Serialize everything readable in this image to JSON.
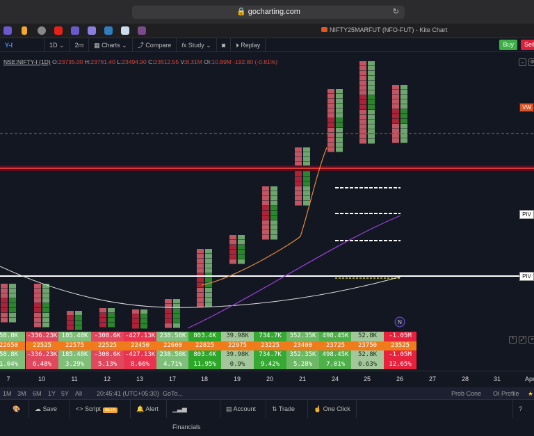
{
  "browser": {
    "url": "gocharting.com",
    "tab_title": "NIFTY25MARFUT (NFO-FUT) - Kite Chart"
  },
  "toolbar": {
    "symbol": "Y-I",
    "interval": "1D",
    "timeframe": "2m",
    "charts": "Charts",
    "compare": "Compare",
    "study": "Study",
    "replay": "Replay",
    "buy": "Buy",
    "sell": "Sell"
  },
  "legend": {
    "symbol": "NSE:NIFTY-I (1D)",
    "o_label": "O:",
    "o": "23735.00",
    "h_label": "H:",
    "h": "23761.40",
    "l_label": "L:",
    "l": "23494.90",
    "c_label": "C:",
    "c": "23512.55",
    "v_label": "V:",
    "v": "8.31M",
    "oi_label": "OI:",
    "oi": "10.89M",
    "change": "-192.80",
    "change_pct": "(-0.81%)"
  },
  "right_labels": {
    "vwap": "VW",
    "pivot1": "PIV",
    "pivot2": "PIV"
  },
  "marker": "N",
  "table": {
    "columns": [
      {
        "day": "7",
        "r1": "58.8K",
        "r2": "22650",
        "r3": "58.8K",
        "r4": "1.04%",
        "color": "#7fbf7a"
      },
      {
        "day": "10",
        "r1": "-336.23K",
        "r2": "22525",
        "r3": "-336.23K",
        "r4": "6.48%",
        "color": "#e0485e"
      },
      {
        "day": "11",
        "r1": "185.48K",
        "r2": "22575",
        "r3": "185.48K",
        "r4": "3.29%",
        "color": "#7fbf7a"
      },
      {
        "day": "12",
        "r1": "-300.6K",
        "r2": "22525",
        "r3": "-300.6K",
        "r4": "5.13%",
        "color": "#e0485e"
      },
      {
        "day": "13",
        "r1": "-427.13K",
        "r2": "22450",
        "r3": "-427.13K",
        "r4": "8.66%",
        "color": "#e8344f"
      },
      {
        "day": "17",
        "r1": "238.58K",
        "r2": "22600",
        "r3": "238.58K",
        "r4": "4.71%",
        "color": "#7fbf7a"
      },
      {
        "day": "18",
        "r1": "803.4K",
        "r2": "22825",
        "r3": "803.4K",
        "r4": "11.95%",
        "color": "#2ea62a"
      },
      {
        "day": "19",
        "r1": "39.98K",
        "r2": "22975",
        "r3": "39.98K",
        "r4": "0.9%",
        "color": "#a3c79a"
      },
      {
        "day": "20",
        "r1": "734.7K",
        "r2": "23225",
        "r3": "734.7K",
        "r4": "9.42%",
        "color": "#36a833"
      },
      {
        "day": "21",
        "r1": "352.35K",
        "r2": "23400",
        "r3": "352.35K",
        "r4": "5.28%",
        "color": "#6cb865"
      },
      {
        "day": "24",
        "r1": "498.45K",
        "r2": "23725",
        "r3": "498.45K",
        "r4": "7.01%",
        "color": "#4fb04a"
      },
      {
        "day": "25",
        "r1": "52.8K",
        "r2": "23750",
        "r3": "52.8K",
        "r4": "0.63%",
        "color": "#a3c79a"
      },
      {
        "day": "26",
        "r1": "-1.05M",
        "r2": "23525",
        "r3": "-1.05M",
        "r4": "12.65%",
        "color": "#e8213d"
      }
    ],
    "price_color": "#f07b1a"
  },
  "xaxis": [
    "7",
    "10",
    "11",
    "12",
    "13",
    "17",
    "18",
    "19",
    "20",
    "21",
    "24",
    "25",
    "26",
    "27",
    "28",
    "31",
    "Apr"
  ],
  "range": {
    "items": [
      "1M",
      "3M",
      "6M",
      "1Y",
      "5Y",
      "All"
    ],
    "time": "20:45:41 (UTC+05:30)",
    "goto": "GoTo...",
    "prob_cone": "Prob Cone",
    "oi_profile": "OI Profile"
  },
  "bottom": {
    "save": "Save",
    "script": "Script",
    "beta": "BETA",
    "alert": "Alert",
    "financials": "Financials",
    "account": "Account",
    "trade": "Trade",
    "one_click": "One Click",
    "help": "?"
  }
}
